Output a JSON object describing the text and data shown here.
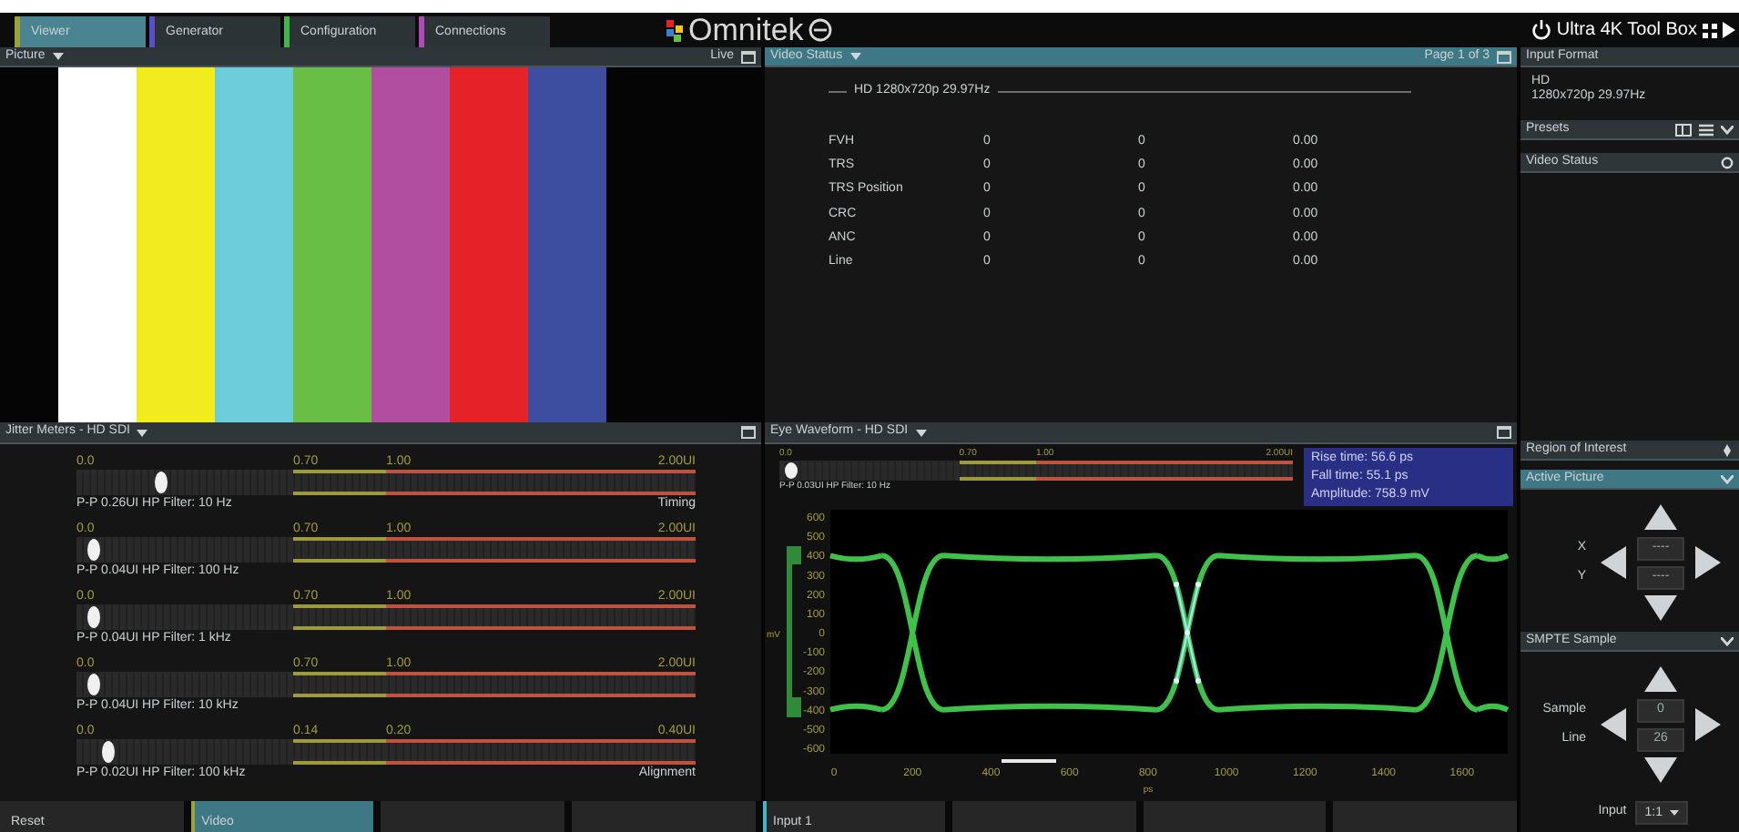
{
  "tabs": [
    {
      "label": "Viewer",
      "selected": true,
      "color": "#9aa23c"
    },
    {
      "label": "Generator",
      "selected": false,
      "color": "#5a4fc8"
    },
    {
      "label": "Configuration",
      "selected": false,
      "color": "#3fb54a"
    },
    {
      "label": "Connections",
      "selected": false,
      "color": "#b04ab8"
    }
  ],
  "logo": {
    "text": "Omnitek"
  },
  "product": {
    "title": "Ultra 4K Tool Box"
  },
  "picture_panel": {
    "title": "Picture",
    "status": "Live",
    "bars": [
      {
        "color": "#ffffff"
      },
      {
        "color": "#f2ec1e"
      },
      {
        "color": "#6cccd9"
      },
      {
        "color": "#69be46"
      },
      {
        "color": "#b24ea0"
      },
      {
        "color": "#e42228"
      },
      {
        "color": "#3d4ea0"
      }
    ]
  },
  "video_status": {
    "title": "Video Status",
    "page": "Page 1 of 3",
    "format": "HD 1280x720p 29.97Hz",
    "rows": [
      {
        "name": "FVH",
        "values": [
          "0",
          "0",
          "0.00"
        ]
      },
      {
        "name": "TRS",
        "values": [
          "0",
          "0",
          "0.00"
        ]
      },
      {
        "name": "TRS Position",
        "values": [
          "0",
          "0",
          "0.00"
        ]
      },
      {
        "name": "CRC",
        "values": [
          "0",
          "0",
          "0.00"
        ]
      },
      {
        "name": "ANC",
        "values": [
          "0",
          "0",
          "0.00"
        ]
      },
      {
        "name": "Line",
        "values": [
          "0",
          "0",
          "0.00"
        ]
      }
    ]
  },
  "jitter_meters": {
    "title": "Jitter Meters - HD SDI",
    "meters": [
      {
        "scale": [
          "0.0",
          "0.70",
          "1.00",
          "2.00UI"
        ],
        "level": 0.135,
        "caption": "P-P 0.26UI HP Filter: 10 Hz",
        "mode": "Timing"
      },
      {
        "scale": [
          "0.0",
          "0.70",
          "1.00",
          "2.00UI"
        ],
        "level": 0.025,
        "caption": "P-P 0.04UI HP Filter: 100 Hz"
      },
      {
        "scale": [
          "0.0",
          "0.70",
          "1.00",
          "2.00UI"
        ],
        "level": 0.025,
        "caption": "P-P 0.04UI HP Filter: 1 kHz"
      },
      {
        "scale": [
          "0.0",
          "0.70",
          "1.00",
          "2.00UI"
        ],
        "level": 0.025,
        "caption": "P-P 0.04UI HP Filter: 10 kHz"
      },
      {
        "scale": [
          "0.0",
          "0.14",
          "0.20",
          "0.40UI"
        ],
        "level": 0.05,
        "caption": "P-P 0.02UI HP Filter: 100 kHz",
        "mode": "Alignment"
      }
    ]
  },
  "eye_waveform": {
    "title": "Eye Waveform - HD SDI",
    "meter": {
      "scale": [
        "0.0",
        "0.70",
        "1.00",
        "2.00UI"
      ],
      "level": 0.02,
      "caption": "P-P 0.03UI HP Filter: 10 Hz"
    },
    "measurements": [
      "Rise time: 56.6 ps",
      "Fall time: 55.1 ps",
      "Amplitude: 758.9 mV"
    ],
    "y_unit": "mV",
    "y_ticks": [
      "600",
      "500",
      "400",
      "300",
      "200",
      "100",
      "0",
      "-100",
      "-200",
      "-300",
      "-400",
      "-500",
      "-600"
    ],
    "x_unit": "ps",
    "x_ticks": [
      "0",
      "200",
      "400",
      "600",
      "800",
      "1000",
      "1200",
      "1400",
      "1600"
    ]
  },
  "bottom_buttons": [
    {
      "label": "Reset",
      "selected": false
    },
    {
      "label": "Video",
      "selected": true,
      "color": "#9aa23c"
    },
    {
      "selected": false
    },
    {
      "selected": false
    },
    {
      "label": "Input 1",
      "selected": false,
      "color": "#3fb6c4"
    },
    {
      "selected": false
    },
    {
      "selected": false
    },
    {
      "selected": false
    }
  ],
  "sidebar": {
    "input_format": {
      "title": "Input Format",
      "lines": [
        "HD",
        "1280x720p 29.97Hz"
      ]
    },
    "presets": {
      "title": "Presets"
    },
    "video_status": {
      "title": "Video Status"
    },
    "region": {
      "title": "Region of Interest",
      "selected": false
    },
    "active_picture": {
      "title": "Active Picture",
      "selected": true,
      "expanded": true,
      "fields": [
        {
          "label": "X",
          "value": "----"
        },
        {
          "label": "Y",
          "value": "----"
        }
      ]
    },
    "smpte_sample": {
      "title": "SMPTE Sample",
      "selected": false,
      "expanded": true,
      "fields": [
        {
          "label": "Sample",
          "value": "0"
        },
        {
          "label": "Line",
          "value": "26"
        }
      ]
    },
    "input": {
      "label": "Input",
      "value": "1:1"
    }
  }
}
